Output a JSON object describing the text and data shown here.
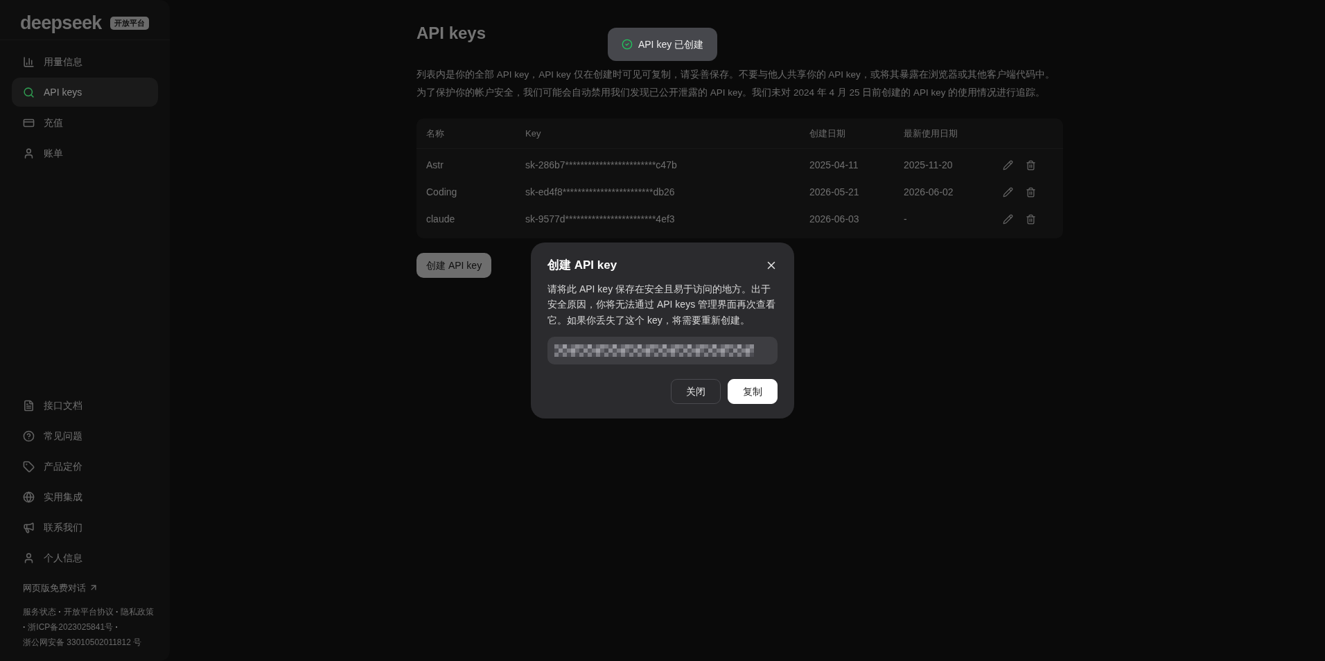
{
  "sidebar": {
    "logo": "deepseek",
    "badge": "开放平台",
    "nav_items": [
      {
        "label": "用量信息",
        "selected": false
      },
      {
        "label": "API keys",
        "selected": true
      },
      {
        "label": "充值",
        "selected": false
      },
      {
        "label": "账单",
        "selected": false
      }
    ],
    "bottom_items": [
      {
        "label": "接口文档"
      },
      {
        "label": "常见问题"
      },
      {
        "label": "产品定价"
      },
      {
        "label": "实用集成"
      },
      {
        "label": "联系我们"
      },
      {
        "label": "个人信息"
      }
    ],
    "chat_link": "网页版免费对话",
    "footer": {
      "links": [
        "服务状态",
        "开放平台协议",
        "隐私政策",
        "浙ICP备2023025841号",
        "浙公网安备 33010502011812 号"
      ],
      "separator": "·"
    }
  },
  "main": {
    "title": "API keys",
    "description": [
      "列表内是你的全部 API key，API key 仅在创建时可见可复制，请妥善保存。不要与他人共享你的 API key，或将其暴露在浏览器或其他客户端代码中。",
      "为了保护你的帐户安全，我们可能会自动禁用我们发现已公开泄露的 API key。我们未对 2024 年 4 月 25 日前创建的 API key 的使用情况进行追踪。"
    ],
    "table": {
      "columns": [
        "名称",
        "Key",
        "创建日期",
        "最新使用日期"
      ],
      "rows": [
        {
          "name": "Astr",
          "key": "sk-286b7************************c47b",
          "created": "2025-04-11",
          "last_used": "2025-11-20"
        },
        {
          "name": "Coding",
          "key": "sk-ed4f8************************db26",
          "created": "2026-05-21",
          "last_used": "2026-06-02"
        },
        {
          "name": "claude",
          "key": "sk-9577d************************4ef3",
          "created": "2026-06-03",
          "last_used": "-"
        }
      ]
    },
    "create_button": "创建 API key"
  },
  "toast": {
    "text": "API key 已创建"
  },
  "dialog": {
    "title": "创建 API key",
    "message": "请将此 API key 保存在安全且易于访问的地方。出于安全原因，你将无法通过 API keys 管理界面再次查看它。如果你丢失了这个 key，将需要重新创建。",
    "buttons": [
      {
        "label": "关闭",
        "kind": "secondary"
      },
      {
        "label": "复制",
        "kind": "primary"
      }
    ]
  }
}
